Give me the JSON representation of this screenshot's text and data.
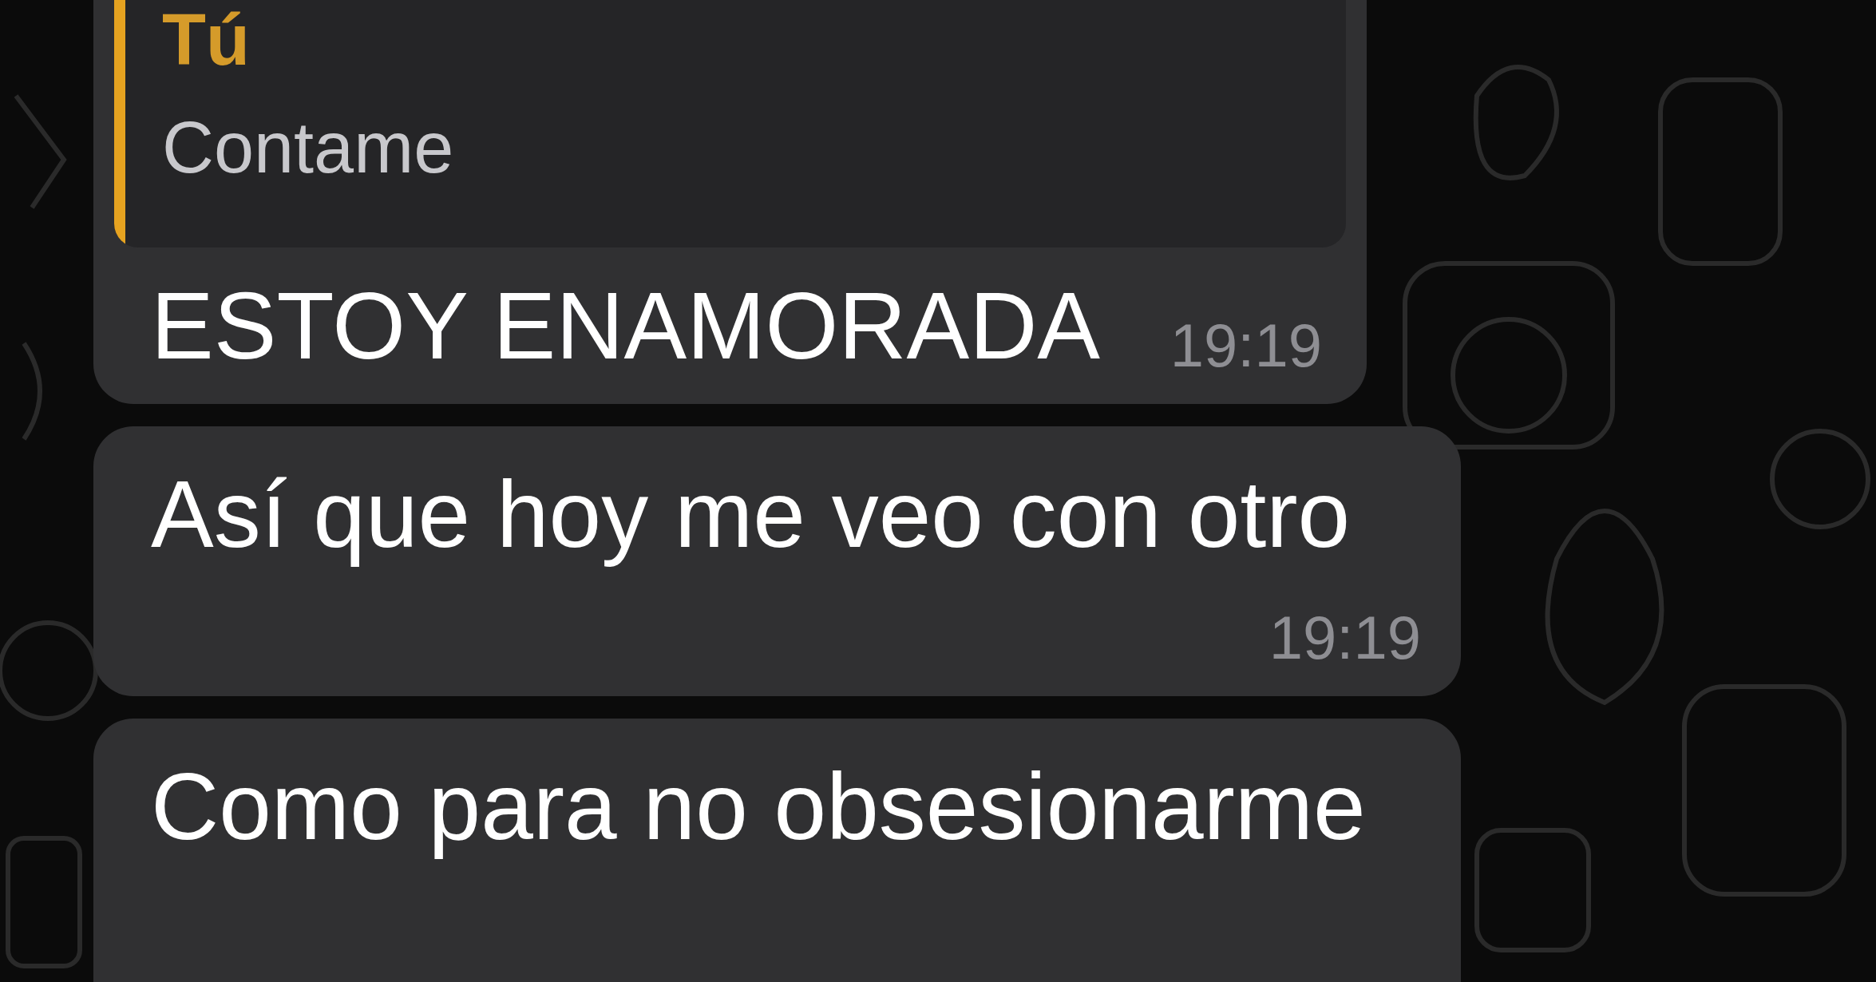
{
  "messages": [
    {
      "kind": "reply",
      "quote": {
        "author": "Tú",
        "text": "Contame"
      },
      "text": "ESTOY ENAMORADA",
      "time": "19:19"
    },
    {
      "kind": "plain",
      "text": "Así que hoy me veo con otro",
      "time": "19:19"
    },
    {
      "kind": "plain",
      "text": "Como para no obsesionarme"
    }
  ]
}
